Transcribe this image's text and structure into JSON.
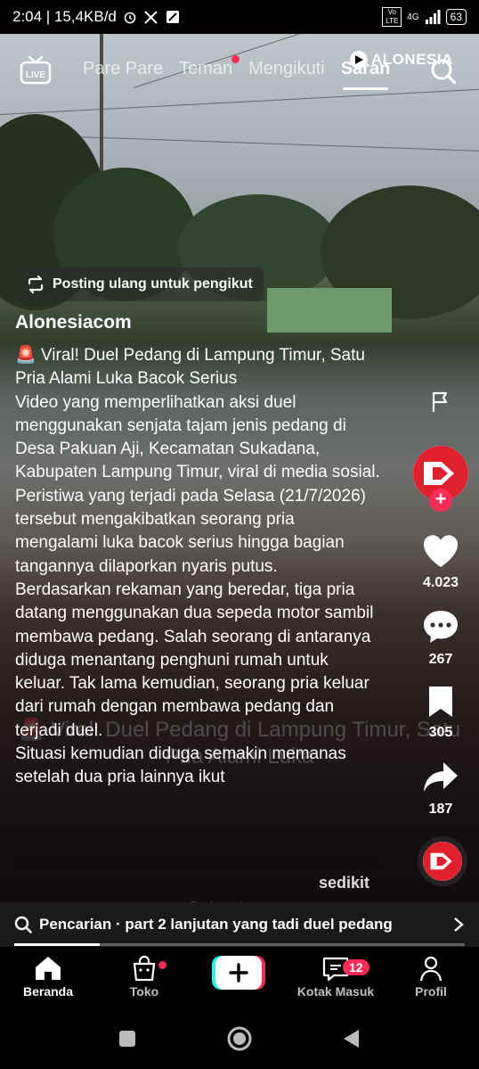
{
  "status_bar": {
    "time_speed": "2:04 | 15,4KB/d",
    "network_label": "4G",
    "volte_label": "Vo LTE",
    "battery": "63"
  },
  "top_nav": {
    "live_label": "LIVE",
    "tabs": [
      {
        "label": "Pare Pare",
        "active": false,
        "dot": false
      },
      {
        "label": "Teman",
        "active": false,
        "dot": true
      },
      {
        "label": "Mengikuti",
        "active": false,
        "dot": false
      },
      {
        "label": "Saran",
        "active": true,
        "dot": false
      }
    ],
    "brand_logo": "ALONESIA"
  },
  "repost": {
    "label": "Posting ulang untuk pengikut"
  },
  "post": {
    "author": "Alonesiacom",
    "caption_lines": [
      "🚨 Viral! Duel Pedang di Lampung Timur, Satu Pria Alami Luka Bacok Serius",
      "Video yang memperlihatkan aksi duel menggunakan senjata tajam jenis pedang di Desa Pakuan Aji, Kecamatan Sukadana, Kabupaten Lampung Timur, viral di media sosial.",
      "Peristiwa yang terjadi pada Selasa (21/7/2026) tersebut mengakibatkan seorang pria mengalami luka bacok serius hingga bagian tangannya dilaporkan nyaris putus.",
      "Berdasarkan rekaman yang beredar, tiga pria datang menggunakan dua sepeda motor sambil membawa pedang. Salah seorang di antaranya diduga menantang penghuni rumah untuk keluar. Tak lama kemudian, seorang pria keluar dari rumah dengan membawa pedang dan terjadi duel.",
      "Situasi kemudian diduga semakin memanas setelah dua pria lainnya ikut"
    ],
    "more_label": "sedikit",
    "overlay_text": "🚨 Viral! Duel Pedang di Lampung Timur, Satu Pria Alami Luka",
    "watermark": "@ alonesiacom"
  },
  "actions": {
    "likes": "4.023",
    "comments": "267",
    "saves": "305",
    "shares": "187"
  },
  "search_suggestion": {
    "text": "Pencarian · part 2 lanjutan yang tadi duel pedang"
  },
  "video_progress": 0.19,
  "bottom_nav": {
    "items": [
      {
        "label": "Beranda",
        "active": true
      },
      {
        "label": "Toko",
        "active": false
      },
      {
        "label": "Kotak Masuk",
        "active": false,
        "badge": "12"
      },
      {
        "label": "Profil",
        "active": false
      }
    ]
  },
  "colors": {
    "accent": "#fe2c55",
    "cyan": "#25f4ee"
  }
}
